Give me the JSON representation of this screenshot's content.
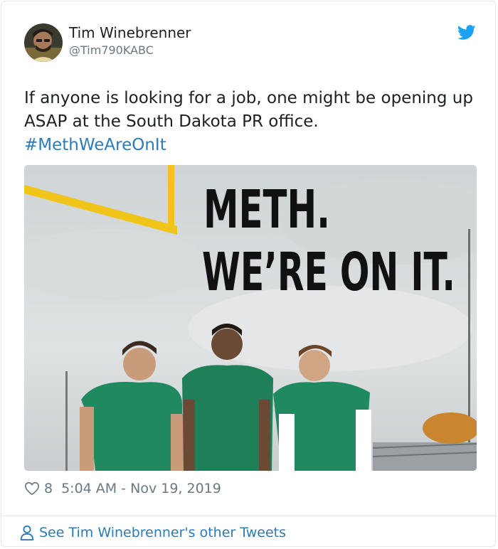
{
  "tweet": {
    "author_name": "Tim Winebrenner",
    "author_handle": "@Tim790KABC",
    "text_line": "If anyone is looking for a job, one might be opening up ASAP at the South Dakota PR office.",
    "hashtag": "#MethWeAreOnIt",
    "likes": "8",
    "timestamp": "5:04 AM - Nov 19, 2019"
  },
  "media": {
    "headline_line1": "METH.",
    "headline_line2": "WE’RE ON IT."
  },
  "footer": {
    "other_tweets_label": "See Tim Winebrenner's other Tweets"
  },
  "colors": {
    "link": "#2b7bb9",
    "text": "#1c2022",
    "muted": "#697882",
    "twitter_blue": "#1da1f2",
    "border": "#e1e8ed"
  },
  "icons": [
    "avatar",
    "twitter-bird-icon",
    "heart-icon",
    "person-icon"
  ]
}
